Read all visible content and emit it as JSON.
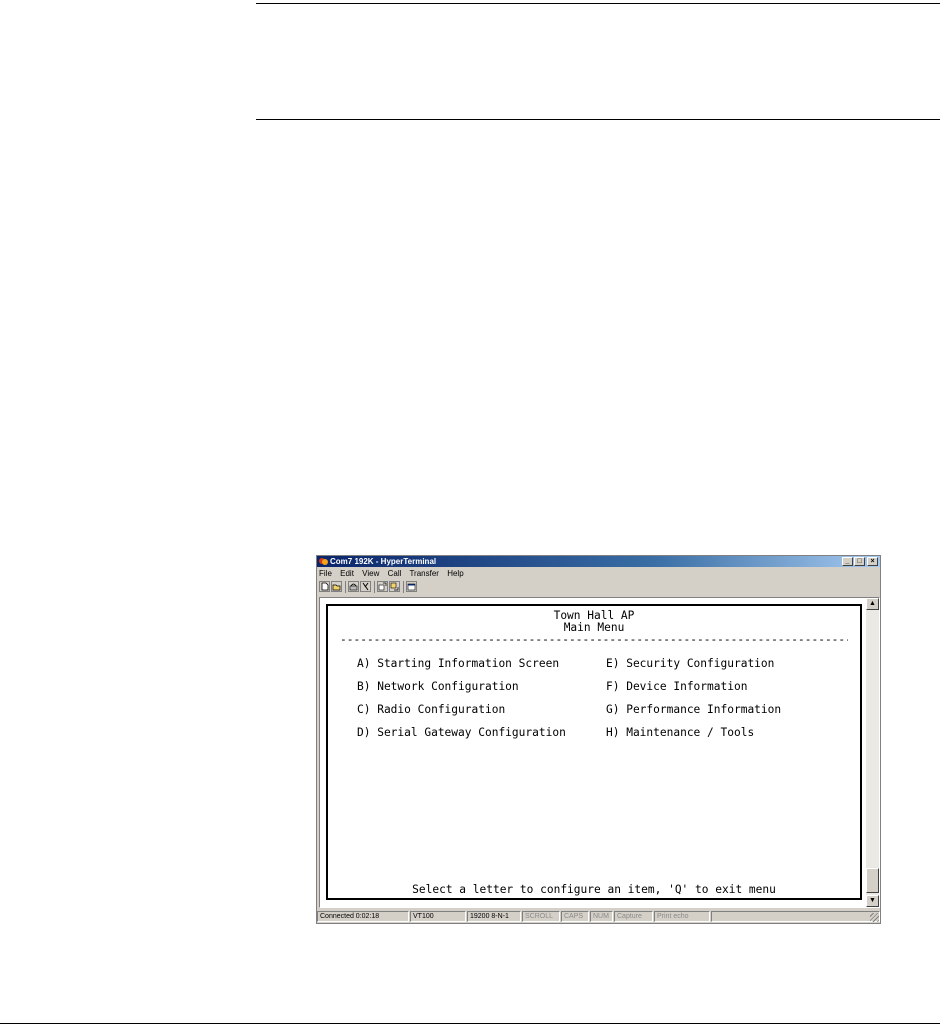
{
  "window": {
    "title": "Com7 192K - HyperTerminal",
    "controls": {
      "minimize": "_",
      "maximize": "□",
      "close": "×"
    }
  },
  "menubar": [
    "File",
    "Edit",
    "View",
    "Call",
    "Transfer",
    "Help"
  ],
  "toolbar": {
    "icons": [
      "new-icon",
      "open-icon",
      "connect-icon",
      "disconnect-icon",
      "send-icon",
      "receive-icon",
      "properties-icon"
    ]
  },
  "terminal": {
    "title": "Town Hall AP",
    "subtitle": "Main Menu",
    "divider": "-------------------------------------------------------------------------------------------------",
    "menu_left": [
      "A) Starting Information Screen",
      "B) Network Configuration",
      "C) Radio Configuration",
      "D) Serial Gateway Configuration"
    ],
    "menu_right": [
      "E) Security Configuration",
      "F) Device Information",
      "G) Performance Information",
      "H) Maintenance / Tools"
    ],
    "prompt": "Select a letter to configure an item, 'Q' to exit menu",
    "cursor": "_"
  },
  "statusbar": {
    "connected": "Connected 0:02:18",
    "emulation": "VT100",
    "settings": "19200 8-N-1",
    "scroll": "SCROLL",
    "caps": "CAPS",
    "num": "NUM",
    "capture": "Capture",
    "print_echo": "Print echo"
  }
}
